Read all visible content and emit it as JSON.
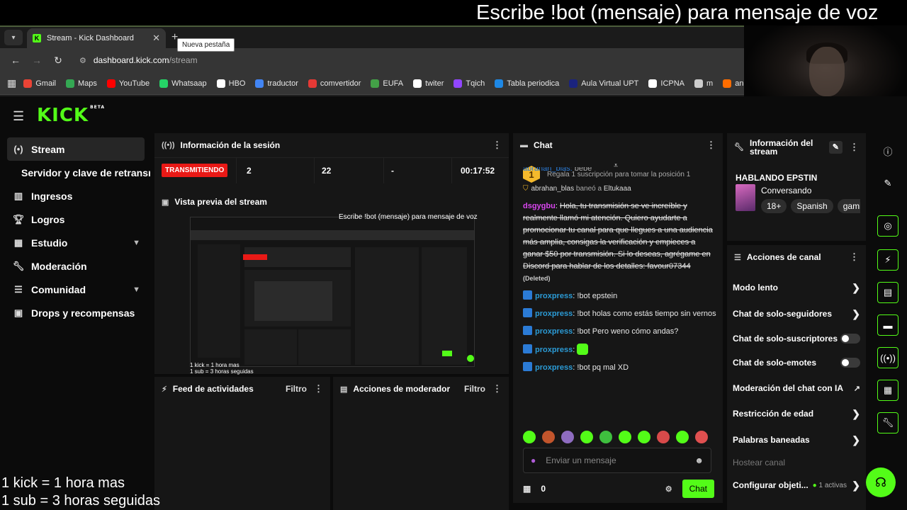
{
  "overlay": {
    "top_text": "Escribe !bot (mensaje) para mensaje de voz",
    "bottom_line1": "1 kick = 1 hora mas",
    "bottom_line2": "1 sub = 3 horas seguidas"
  },
  "browser": {
    "tab_title": "Stream - Kick Dashboard",
    "tooltip": "Nueva pestaña",
    "url_host": "dashboard.kick.com",
    "url_path": "/stream",
    "bookmarks": [
      {
        "label": "Gmail",
        "color": "#ea4335"
      },
      {
        "label": "Maps",
        "color": "#34a853"
      },
      {
        "label": "YouTube",
        "color": "#ff0000"
      },
      {
        "label": "Whatsaap",
        "color": "#25d366"
      },
      {
        "label": "HBO",
        "color": "#ffffff"
      },
      {
        "label": "traductor",
        "color": "#4285f4"
      },
      {
        "label": "comvertidor",
        "color": "#e53935"
      },
      {
        "label": "EUFA",
        "color": "#43a047"
      },
      {
        "label": "twiter",
        "color": "#ffffff"
      },
      {
        "label": "Tqich",
        "color": "#9146ff"
      },
      {
        "label": "Tabla periodica",
        "color": "#1e88e5"
      },
      {
        "label": "Aula Virtual UPT",
        "color": "#1a237e"
      },
      {
        "label": "ICPNA",
        "color": "#ffffff"
      },
      {
        "label": "m",
        "color": "#cccccc"
      },
      {
        "label": "an",
        "color": "#ff6d00"
      }
    ]
  },
  "brand": {
    "logo": "KICK",
    "beta": "BETA",
    "accent": "#53fc18"
  },
  "sidebar": {
    "items": [
      {
        "label": "Stream",
        "icon": "stream-icon"
      },
      {
        "label": "Servidor y clave de retransm",
        "icon": ""
      },
      {
        "label": "Ingresos",
        "icon": "chart-icon"
      },
      {
        "label": "Logros",
        "icon": "trophy-icon"
      },
      {
        "label": "Estudio",
        "icon": "grid-icon"
      },
      {
        "label": "Moderación",
        "icon": "wrench-icon"
      },
      {
        "label": "Comunidad",
        "icon": "community-icon"
      },
      {
        "label": "Drops y recompensas",
        "icon": "gift-icon"
      }
    ]
  },
  "session": {
    "title": "Información de la sesión",
    "status": "TRANSMITIENDO",
    "viewers": "2",
    "followers": "22",
    "other": "-",
    "duration": "00:17:52"
  },
  "preview": {
    "title": "Vista previa del stream"
  },
  "activity": {
    "title": "Feed de actividades",
    "filter": "Filtro"
  },
  "modactions": {
    "title": "Acciones de moderador",
    "filter": "Filtro"
  },
  "chat": {
    "title": "Chat",
    "pinned_rank": "1",
    "pinned_text": "Regala 1 suscripción para tomar la posición 1",
    "partial_user": "abrahan_blas:",
    "partial_text": "bebe",
    "ban_user": "abrahan_blas",
    "ban_verb": "baneó a",
    "ban_target": "Eltukaaa",
    "spam_user": "dsgygbu",
    "spam_text": "Hola, tu transmisión se ve increíble y realmente llamó mi atención. Quiero ayudarte a promocionar tu canal para que llegues a una audiencia más amplia, consigas la verificación y empieces a ganar $50 por transmisión. Si lo deseas, agrégame en Discord para hablar de los detalles: favour07344",
    "deleted_label": "(Deleted)",
    "messages": [
      {
        "user": "proxpress",
        "text": "!bot epstein"
      },
      {
        "user": "proxpress",
        "text": "!bot holas como estás tiempo sin vernos"
      },
      {
        "user": "proxpress",
        "text": "!bot Pero weno cómo andas?"
      },
      {
        "user": "proxpress",
        "text": ""
      },
      {
        "user": "proxpress",
        "text": "!bot pq mal XD"
      }
    ],
    "input_placeholder": "Enviar un mensaje",
    "gift_count": "0",
    "send_label": "Chat"
  },
  "stream_info": {
    "title": "Información del stream",
    "stream_title": "HABLANDO EPSTIN",
    "category": "Conversando",
    "tags": [
      "18+",
      "Spanish",
      "gami"
    ]
  },
  "channel_actions": {
    "title": "Acciones de canal",
    "items": [
      {
        "label": "Modo lento",
        "control": "arrow"
      },
      {
        "label": "Chat de solo-seguidores",
        "control": "arrow"
      },
      {
        "label": "Chat de solo-suscriptores",
        "control": "toggle"
      },
      {
        "label": "Chat de solo-emotes",
        "control": "toggle"
      },
      {
        "label": "Moderación del chat con IA",
        "control": "external"
      },
      {
        "label": "Restricción de edad",
        "control": "arrow"
      },
      {
        "label": "Palabras baneadas",
        "control": "arrow"
      },
      {
        "label": "Hostear canal",
        "control": "none"
      },
      {
        "label": "Configurar objeti...",
        "control": "arrow"
      }
    ],
    "active_count": "1 activas"
  }
}
